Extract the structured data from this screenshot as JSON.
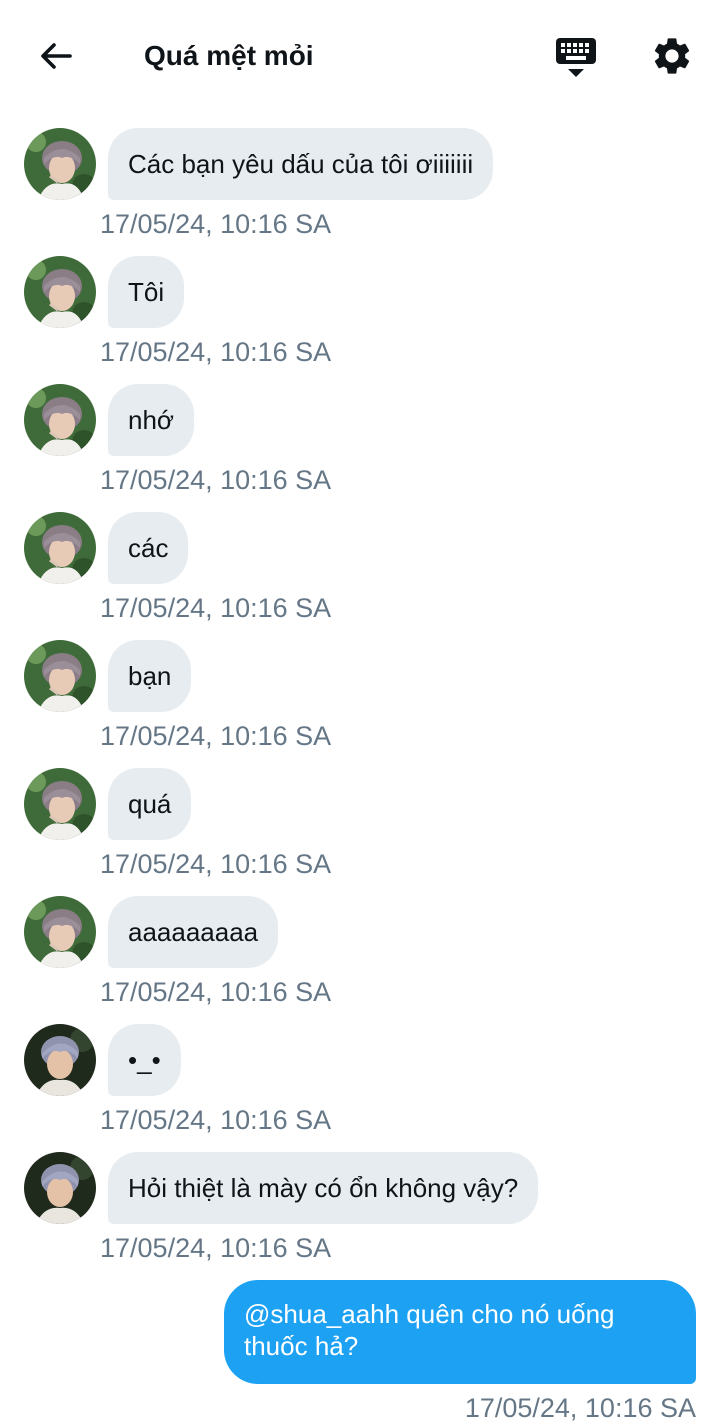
{
  "header": {
    "title": "Quá mệt mỏi",
    "back_icon": "arrow-left-icon",
    "keyboard_icon": "keyboard-icon",
    "settings_icon": "gear-icon"
  },
  "messages": [
    {
      "text": "Các bạn yêu dấu của tôi ơiiiiiii",
      "time": "17/05/24, 10:16 SA",
      "avatar": "avatar-a"
    },
    {
      "text": "Tôi",
      "time": "17/05/24, 10:16 SA",
      "avatar": "avatar-a"
    },
    {
      "text": "nhớ",
      "time": "17/05/24, 10:16 SA",
      "avatar": "avatar-a"
    },
    {
      "text": "các",
      "time": "17/05/24, 10:16 SA",
      "avatar": "avatar-a"
    },
    {
      "text": "bạn",
      "time": "17/05/24, 10:16 SA",
      "avatar": "avatar-a"
    },
    {
      "text": "quá",
      "time": "17/05/24, 10:16 SA",
      "avatar": "avatar-a"
    },
    {
      "text": "aaaaaaaaa",
      "time": "17/05/24, 10:16 SA",
      "avatar": "avatar-a"
    },
    {
      "text": "•_•",
      "time": "17/05/24, 10:16 SA",
      "avatar": "avatar-b"
    },
    {
      "text": "Hỏi thiệt là mày có ổn không vậy?",
      "time": "17/05/24, 10:16 SA",
      "avatar": "avatar-b"
    }
  ],
  "outgoing": {
    "text": "@shua_aahh quên cho nó uống thuốc hả?",
    "time": "17/05/24, 10:16 SA"
  },
  "colors": {
    "incoming_bubble": "#e6ecf0",
    "outgoing_bubble": "#1da1f2",
    "timestamp": "#657786"
  }
}
